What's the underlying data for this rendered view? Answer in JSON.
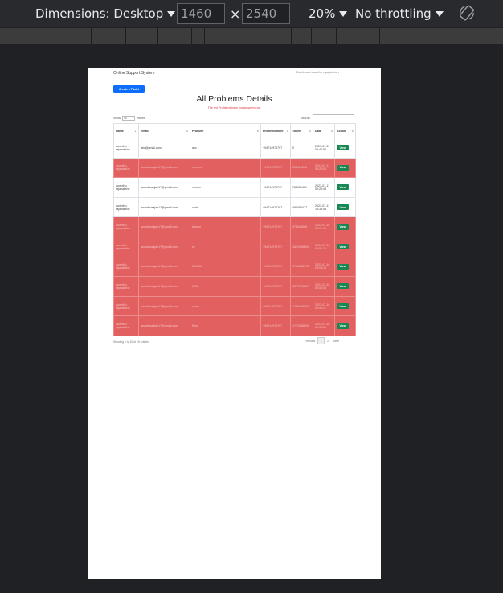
{
  "devtools": {
    "dimensions_label": "Dimensions: Desktop",
    "width_value": "1460",
    "height_value": "2540",
    "times": "×",
    "zoom": "20%",
    "throttling": "No throttling"
  },
  "colors": {
    "primary": "#0d6efd",
    "success": "#198754",
    "danger": "#dc3545",
    "unsolved_row": "#e36060"
  },
  "navbar": {
    "brand": "Online Support System",
    "right": "Dashboard    awanthu rajapakshe ▾"
  },
  "create_button": "Create a Tikdet",
  "page_title": "All Problems Details",
  "subtitle": "The red Problems have not answered yet",
  "controls": {
    "show": "Show",
    "entries_value": "10",
    "entries": "entries",
    "search_label": "Search:"
  },
  "table": {
    "headers": [
      "Name",
      "Email",
      "Problem",
      "Phone Number",
      "Token",
      "Date",
      "Action"
    ],
    "rows": [
      {
        "name": "awanthu rajapakshe",
        "email": "abc@gmail.com",
        "problem": "abc",
        "phone": "+94714971797",
        "token": "0",
        "date": "2021-07-11 05:47:53",
        "action": "View",
        "unsolved": false
      },
      {
        "name": "awanthu rajapakshe",
        "email": "awanthusajan1?@gmail.com",
        "problem": "xxxxxxx",
        "phone": "+94714971797",
        "token": "235118846",
        "date": "2021-07-11 09:28:03",
        "action": "View",
        "unsolved": true
      },
      {
        "name": "awanthu rajapakshe",
        "email": "awanthusajan1?@gmail.com",
        "problem": "xxxxxx",
        "phone": "+94714971797",
        "token": "784062461",
        "date": "2021-07-11 09:28:48",
        "action": "View",
        "unsolved": false
      },
      {
        "name": "awanthu rajapakshe",
        "email": "awanthusajan1?@gmail.com",
        "problem": "vada",
        "phone": "+94714971797",
        "token": "490082477",
        "date": "2021-07-11 18:36:48",
        "action": "View",
        "unsolved": false
      },
      {
        "name": "awanthu rajapakshe",
        "email": "awanthusajan1?@gmail.com",
        "problem": "edwad",
        "phone": "+94714971797",
        "token": "374643698",
        "date": "2021-07-16 09:01:40",
        "action": "View",
        "unsolved": true
      },
      {
        "name": "awanthu rajapakshe",
        "email": "awanthusajan1?@gmail.com",
        "problem": "sv",
        "phone": "+94714971797",
        "token": "1821996664",
        "date": "2021-07-16 09:01:16",
        "action": "View",
        "unsolved": true
      },
      {
        "name": "awanthu rajapakshe",
        "email": "awanthusajan1?@gmail.com",
        "problem": "564546",
        "phone": "+94714971797",
        "token": "1719646478",
        "date": "2021-07-16 09:04:18",
        "action": "View",
        "unsolved": true
      },
      {
        "name": "awanthu rajapakshe",
        "email": "awanthusajan1?@gmail.com",
        "problem": "6756",
        "phone": "+94714971797",
        "token": "1571784867",
        "date": "2021-07-16 09:04:08",
        "action": "View",
        "unsolved": true
      },
      {
        "name": "awanthu rajapakshe",
        "email": "awanthusajan1?@gmail.com",
        "problem": "xxxxx",
        "phone": "+94714971797",
        "token": "1785406194",
        "date": "2021-07-16 09:04:17",
        "action": "View",
        "unsolved": true
      },
      {
        "name": "awanthu rajapakshe",
        "email": "awanthusajan1?@gmail.com",
        "problem": "ffvvc",
        "phone": "+94714971797",
        "token": "1771366509",
        "date": "2021-07-16 09:05:01",
        "action": "View",
        "unsolved": true
      }
    ]
  },
  "footer": {
    "info": "Showing 1 to 10 of 15 entries",
    "previous": "Previous",
    "page1": "1",
    "page2": "2",
    "next": "Next"
  }
}
